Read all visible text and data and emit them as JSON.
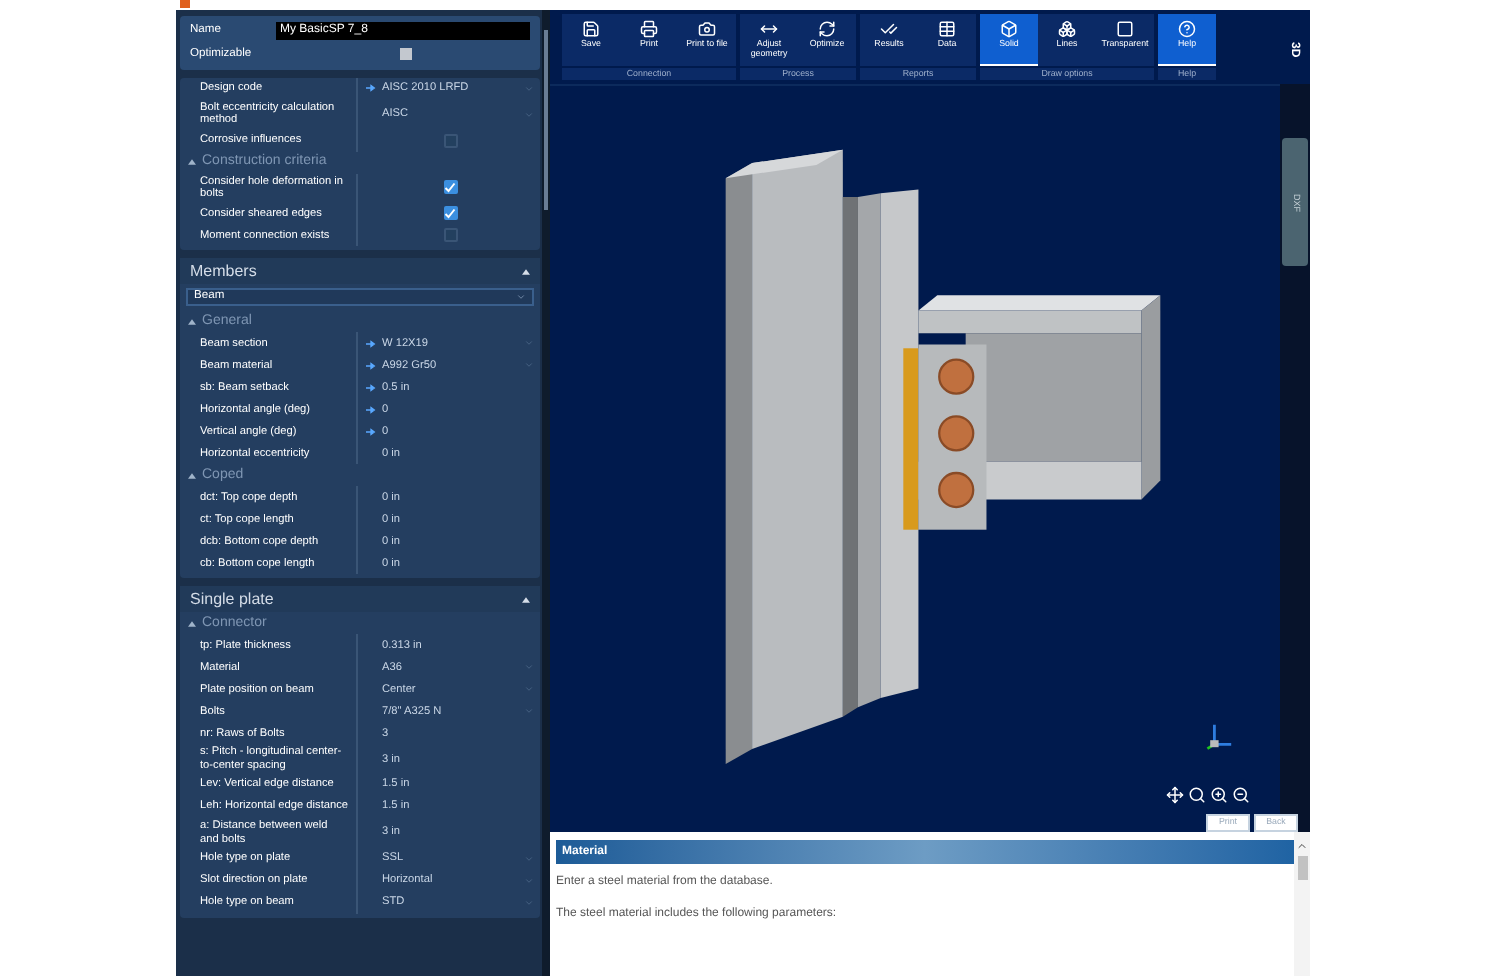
{
  "name_field": {
    "label": "Name",
    "value": "My BasicSP 7_8"
  },
  "optimizable": {
    "label": "Optimizable",
    "checked": false
  },
  "top_rows": [
    {
      "kind": "select",
      "label": "Design code",
      "value": "AISC 2010 LRFD",
      "marked": true
    },
    {
      "kind": "select",
      "label": "Bolt eccentricity calculation method",
      "value": "AISC",
      "marked": false
    },
    {
      "kind": "check",
      "label": "Corrosive influences",
      "checked": false
    }
  ],
  "top_groups": [
    {
      "title": "Construction criteria",
      "expanded": true,
      "rows": [
        {
          "kind": "check",
          "label": "Consider hole deformation in bolts",
          "checked": true
        },
        {
          "kind": "check",
          "label": "Consider sheared edges",
          "checked": true
        },
        {
          "kind": "check",
          "label": "Moment connection exists",
          "checked": false
        }
      ]
    }
  ],
  "sections": [
    {
      "title": "Members",
      "expanded": true,
      "selector": "Beam",
      "groups": [
        {
          "title": "General",
          "expanded": true,
          "rows": [
            {
              "kind": "select",
              "label": "Beam section",
              "value": "W 12X19",
              "marked": true
            },
            {
              "kind": "select",
              "label": "Beam material",
              "value": "A992 Gr50",
              "marked": true
            },
            {
              "kind": "text",
              "label": "sb:  Beam setback",
              "value": "0.5 in",
              "marked": true
            },
            {
              "kind": "text",
              "label": "Horizontal angle (deg)",
              "value": "0",
              "marked": true
            },
            {
              "kind": "text",
              "label": "Vertical angle (deg)",
              "value": "0",
              "marked": true
            },
            {
              "kind": "text",
              "label": "Horizontal eccentricity",
              "value": "0 in",
              "marked": false
            }
          ]
        },
        {
          "title": "Coped",
          "expanded": true,
          "rows": [
            {
              "kind": "text",
              "label": "dct:  Top cope depth",
              "value": "0 in",
              "marked": false
            },
            {
              "kind": "text",
              "label": "ct:  Top cope length",
              "value": "0 in",
              "marked": false
            },
            {
              "kind": "text",
              "label": "dcb:  Bottom cope depth",
              "value": "0 in",
              "marked": false
            },
            {
              "kind": "text",
              "label": "cb:  Bottom cope length",
              "value": "0 in",
              "marked": false
            }
          ]
        }
      ]
    },
    {
      "title": "Single plate",
      "expanded": true,
      "groups": [
        {
          "title": "Connector",
          "expanded": true,
          "rows": [
            {
              "kind": "text",
              "label": "tp:  Plate thickness",
              "value": "0.313 in",
              "marked": false
            },
            {
              "kind": "select",
              "label": "Material",
              "value": "A36",
              "marked": false
            },
            {
              "kind": "select",
              "label": "Plate position on beam",
              "value": "Center",
              "marked": false
            },
            {
              "kind": "select",
              "label": "Bolts",
              "value": "7/8\" A325 N",
              "marked": false
            },
            {
              "kind": "text",
              "label": "nr:  Raws of Bolts",
              "value": "3",
              "marked": false
            },
            {
              "kind": "text",
              "label": "s:  Pitch - longitudinal center-to-center spacing",
              "value": "3 in",
              "marked": false
            },
            {
              "kind": "text",
              "label": "Lev:  Vertical edge distance",
              "value": "1.5 in",
              "marked": false
            },
            {
              "kind": "text",
              "label": "Leh:  Horizontal edge distance",
              "value": "1.5 in",
              "marked": false
            },
            {
              "kind": "text",
              "label": "a:  Distance between weld and bolts",
              "value": "3 in",
              "marked": false
            },
            {
              "kind": "select",
              "label": "Hole type on plate",
              "value": "SSL",
              "marked": false
            },
            {
              "kind": "select",
              "label": "Slot direction on plate",
              "value": "Horizontal",
              "marked": false
            },
            {
              "kind": "select",
              "label": "Hole type on beam",
              "value": "STD",
              "marked": false
            }
          ]
        }
      ]
    }
  ],
  "toolbar": [
    {
      "group": "Connection",
      "tools": [
        {
          "kind": "save",
          "label": "Save",
          "selected": false
        },
        {
          "kind": "print",
          "label": "Print",
          "selected": false
        },
        {
          "kind": "camera",
          "label": "Print to file",
          "selected": false
        }
      ]
    },
    {
      "group": "Process",
      "tools": [
        {
          "kind": "adjust",
          "label": "Adjust geometry",
          "selected": false
        },
        {
          "kind": "optimize",
          "label": "Optimize",
          "selected": false
        }
      ]
    },
    {
      "group": "Reports",
      "tools": [
        {
          "kind": "results",
          "label": "Results",
          "selected": false
        },
        {
          "kind": "data",
          "label": "Data",
          "selected": false
        }
      ]
    },
    {
      "group": "Draw options",
      "tools": [
        {
          "kind": "solid",
          "label": "Solid",
          "selected": true
        },
        {
          "kind": "lines",
          "label": "Lines",
          "selected": false
        },
        {
          "kind": "transparent",
          "label": "Transparent",
          "selected": false
        }
      ]
    },
    {
      "group": "Help",
      "tools": [
        {
          "kind": "help",
          "label": "Help",
          "selected": true
        }
      ]
    }
  ],
  "view_label": "3D",
  "side_tab": "DXF",
  "help": {
    "buttons": [
      "Print",
      "Back"
    ],
    "title": "Material",
    "paragraphs": [
      "Enter a steel material from the database.",
      "The steel material includes the following parameters:"
    ]
  }
}
